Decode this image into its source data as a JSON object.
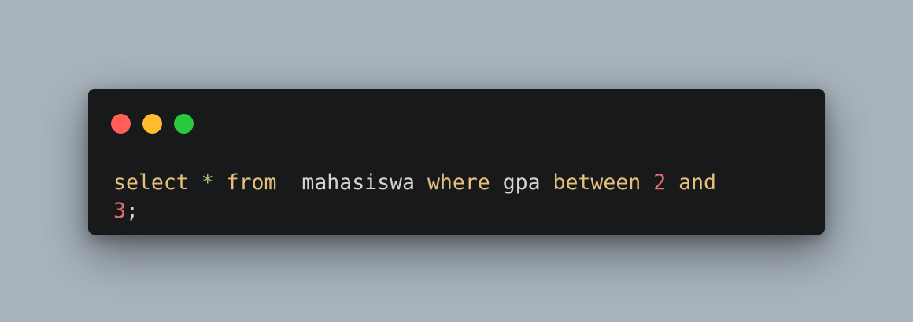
{
  "window": {
    "controls": {
      "close_color": "#ff5f57",
      "minimize_color": "#febc2e",
      "maximize_color": "#28c840"
    }
  },
  "code": {
    "line1": {
      "t1": "select",
      "t2": "*",
      "t3": "from",
      "t4": "mahasiswa",
      "t5": "where",
      "t6": "gpa",
      "t7": "between",
      "t8": "2",
      "t9": "and"
    },
    "line2": {
      "t1": "3",
      "t2": ";"
    },
    "colors": {
      "keyword": "#e5c07b",
      "operator": "#98c379",
      "identifier": "#d4d4d4",
      "number": "#e06c75"
    }
  }
}
